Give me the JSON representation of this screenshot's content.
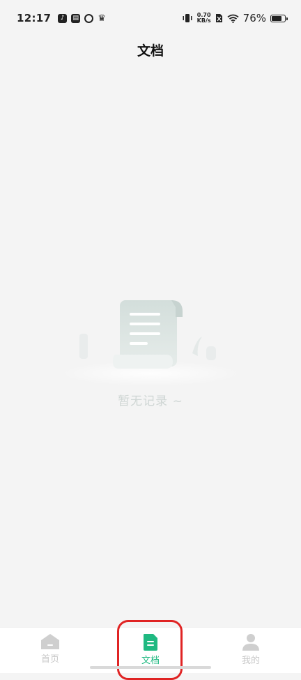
{
  "status_bar": {
    "time": "12:17",
    "net_speed_value": "0.70",
    "net_speed_unit": "KB/s",
    "battery_percent": "76%",
    "battery_level": 0.76
  },
  "header": {
    "title": "文档"
  },
  "empty_state": {
    "message": "暂无记录 ~"
  },
  "tabs": [
    {
      "label": "首页",
      "icon": "home-icon",
      "active": false
    },
    {
      "label": "文档",
      "icon": "document-icon",
      "active": true
    },
    {
      "label": "我的",
      "icon": "profile-icon",
      "active": false
    }
  ],
  "colors": {
    "accent": "#1fb981",
    "inactive": "#c8c8c8",
    "highlight": "#e02424",
    "background": "#f4f4f4"
  }
}
